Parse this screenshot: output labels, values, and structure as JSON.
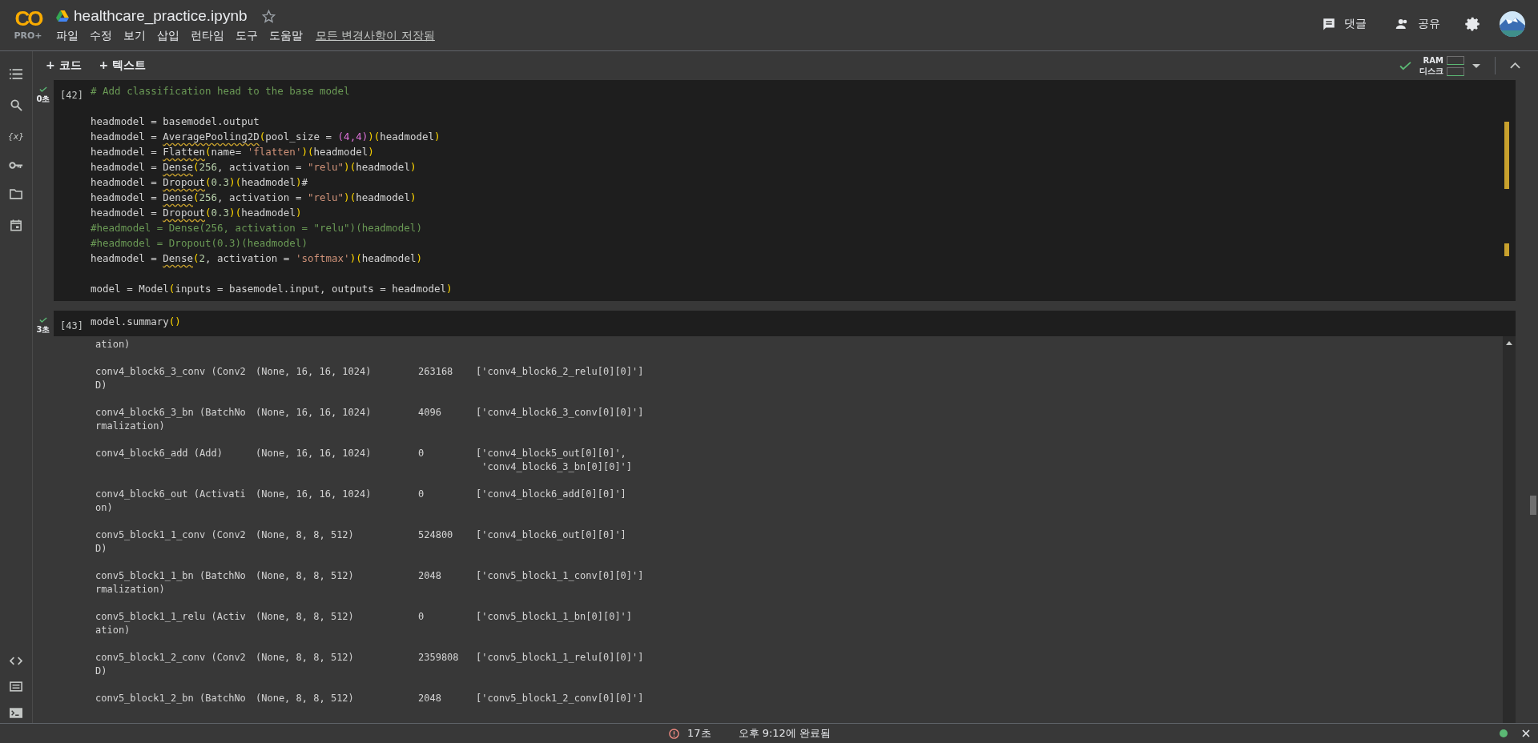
{
  "header": {
    "logo": "CO",
    "plan": "PRO+",
    "title": "healthcare_practice.ipynb",
    "starred": false,
    "menu": [
      "파일",
      "수정",
      "보기",
      "삽입",
      "런타임",
      "도구",
      "도움말"
    ],
    "save_status": "모든 변경사항이 저장됨",
    "comment": "댓글",
    "share": "공유"
  },
  "sidebar": {
    "variables": "{x}"
  },
  "toolbar": {
    "add_code": "+ 코드",
    "add_text": "+ 텍스트",
    "ram": "RAM",
    "disk": "디스크",
    "connected": true
  },
  "cells": [
    {
      "prompt": "[42]",
      "time": "0초",
      "done": true,
      "lines": [
        [
          {
            "kind": "comment",
            "text": "# Add classification head to the base model"
          }
        ],
        [
          {
            "kind": "blank"
          },
          {
            "kind": "plain",
            "text": "headmodel = basemodel.output"
          }
        ],
        [
          {
            "kind": "plain",
            "text": "headmodel = "
          },
          {
            "kind": "squiggle",
            "text": "AveragePooling2D"
          },
          {
            "kind": "paren",
            "text": "("
          },
          {
            "kind": "plain",
            "text": "pool_size = "
          },
          {
            "kind": "paren2",
            "text": "(4,4)"
          },
          {
            "kind": "paren",
            "text": ")"
          },
          {
            "kind": "paren",
            "text": "("
          },
          {
            "kind": "plain",
            "text": "headmodel"
          },
          {
            "kind": "paren",
            "text": ")"
          }
        ],
        [
          {
            "kind": "plain",
            "text": "headmodel = "
          },
          {
            "kind": "squiggle",
            "text": "Flatten"
          },
          {
            "kind": "paren",
            "text": "("
          },
          {
            "kind": "plain",
            "text": "name= "
          },
          {
            "kind": "string",
            "text": "'flatten'"
          },
          {
            "kind": "paren",
            "text": ")"
          },
          {
            "kind": "paren",
            "text": "("
          },
          {
            "kind": "plain",
            "text": "headmodel"
          },
          {
            "kind": "paren",
            "text": ")"
          }
        ],
        [
          {
            "kind": "plain",
            "text": "headmodel = "
          },
          {
            "kind": "squiggle",
            "text": "Dense"
          },
          {
            "kind": "paren",
            "text": "("
          },
          {
            "kind": "number",
            "text": "256"
          },
          {
            "kind": "plain",
            "text": ", activation = "
          },
          {
            "kind": "string",
            "text": "\"relu\""
          },
          {
            "kind": "paren",
            "text": ")"
          },
          {
            "kind": "paren",
            "text": "("
          },
          {
            "kind": "plain",
            "text": "headmodel"
          },
          {
            "kind": "paren",
            "text": ")"
          }
        ],
        [
          {
            "kind": "plain",
            "text": "headmodel = "
          },
          {
            "kind": "squiggle",
            "text": "Dropout"
          },
          {
            "kind": "paren",
            "text": "("
          },
          {
            "kind": "number",
            "text": "0.3"
          },
          {
            "kind": "paren",
            "text": ")"
          },
          {
            "kind": "paren",
            "text": "("
          },
          {
            "kind": "plain",
            "text": "headmodel"
          },
          {
            "kind": "paren",
            "text": ")"
          },
          {
            "kind": "plain",
            "text": "#"
          }
        ],
        [
          {
            "kind": "plain",
            "text": "headmodel = "
          },
          {
            "kind": "squiggle",
            "text": "Dense"
          },
          {
            "kind": "paren",
            "text": "("
          },
          {
            "kind": "number",
            "text": "256"
          },
          {
            "kind": "plain",
            "text": ", activation = "
          },
          {
            "kind": "string",
            "text": "\"relu\""
          },
          {
            "kind": "paren",
            "text": ")"
          },
          {
            "kind": "paren",
            "text": "("
          },
          {
            "kind": "plain",
            "text": "headmodel"
          },
          {
            "kind": "paren",
            "text": ")"
          }
        ],
        [
          {
            "kind": "plain",
            "text": "headmodel = "
          },
          {
            "kind": "squiggle",
            "text": "Dropout"
          },
          {
            "kind": "paren",
            "text": "("
          },
          {
            "kind": "number",
            "text": "0.3"
          },
          {
            "kind": "paren",
            "text": ")"
          },
          {
            "kind": "paren",
            "text": "("
          },
          {
            "kind": "plain",
            "text": "headmodel"
          },
          {
            "kind": "paren",
            "text": ")"
          }
        ],
        [
          {
            "kind": "comment",
            "text": "#headmodel = Dense(256, activation = \"relu\")(headmodel)"
          }
        ],
        [
          {
            "kind": "comment",
            "text": "#headmodel = Dropout(0.3)(headmodel)"
          }
        ],
        [
          {
            "kind": "plain",
            "text": "headmodel = "
          },
          {
            "kind": "squiggle",
            "text": "Dense"
          },
          {
            "kind": "paren",
            "text": "("
          },
          {
            "kind": "number",
            "text": "2"
          },
          {
            "kind": "plain",
            "text": ", activation = "
          },
          {
            "kind": "string",
            "text": "'softmax'"
          },
          {
            "kind": "paren",
            "text": ")"
          },
          {
            "kind": "paren",
            "text": "("
          },
          {
            "kind": "plain",
            "text": "headmodel"
          },
          {
            "kind": "paren",
            "text": ")"
          }
        ],
        [
          {
            "kind": "blank"
          },
          {
            "kind": "plain",
            "text": "model = Model"
          },
          {
            "kind": "paren",
            "text": "("
          },
          {
            "kind": "plain",
            "text": "inputs = basemodel.input, outputs = headmodel"
          },
          {
            "kind": "paren",
            "text": ")"
          }
        ]
      ]
    },
    {
      "prompt": "[43]",
      "time": "3초",
      "done": true,
      "lines": [
        [
          {
            "kind": "plain",
            "text": "model.summary"
          },
          {
            "kind": "paren",
            "text": "()"
          }
        ]
      ],
      "output": {
        "continuation": "ation)",
        "rows": [
          {
            "layer": [
              "conv4_block6_3_conv (Conv2",
              "D)"
            ],
            "shape": "(None, 16, 16, 1024)",
            "params": "263168",
            "connected": [
              "['conv4_block6_2_relu[0][0]']"
            ]
          },
          {
            "layer": [
              "conv4_block6_3_bn (BatchNo",
              "rmalization)"
            ],
            "shape": "(None, 16, 16, 1024)",
            "params": "4096",
            "connected": [
              "['conv4_block6_3_conv[0][0]']"
            ]
          },
          {
            "layer": [
              "conv4_block6_add (Add)"
            ],
            "shape": "(None, 16, 16, 1024)",
            "params": "0",
            "connected": [
              "['conv4_block5_out[0][0]',",
              " 'conv4_block6_3_bn[0][0]']"
            ]
          },
          {
            "layer": [
              "conv4_block6_out (Activati",
              "on)"
            ],
            "shape": "(None, 16, 16, 1024)",
            "params": "0",
            "connected": [
              "['conv4_block6_add[0][0]']"
            ]
          },
          {
            "layer": [
              "conv5_block1_1_conv (Conv2",
              "D)"
            ],
            "shape": "(None, 8, 8, 512)",
            "params": "524800",
            "connected": [
              "['conv4_block6_out[0][0]']"
            ]
          },
          {
            "layer": [
              "conv5_block1_1_bn (BatchNo",
              "rmalization)"
            ],
            "shape": "(None, 8, 8, 512)",
            "params": "2048",
            "connected": [
              "['conv5_block1_1_conv[0][0]']"
            ]
          },
          {
            "layer": [
              "conv5_block1_1_relu (Activ",
              "ation)"
            ],
            "shape": "(None, 8, 8, 512)",
            "params": "0",
            "connected": [
              "['conv5_block1_1_bn[0][0]']"
            ]
          },
          {
            "layer": [
              "conv5_block1_2_conv (Conv2",
              "D)"
            ],
            "shape": "(None, 8, 8, 512)",
            "params": "2359808",
            "connected": [
              "['conv5_block1_1_relu[0][0]']"
            ]
          },
          {
            "layer": [
              "conv5_block1_2_bn (BatchNo"
            ],
            "shape": "(None, 8, 8, 512)",
            "params": "2048",
            "connected": [
              "['conv5_block1_2_conv[0][0]']"
            ]
          }
        ]
      }
    }
  ],
  "status_bar": {
    "duration": "17초",
    "completed": "오후 9:12에 완료됨",
    "error": true,
    "connected": true
  }
}
